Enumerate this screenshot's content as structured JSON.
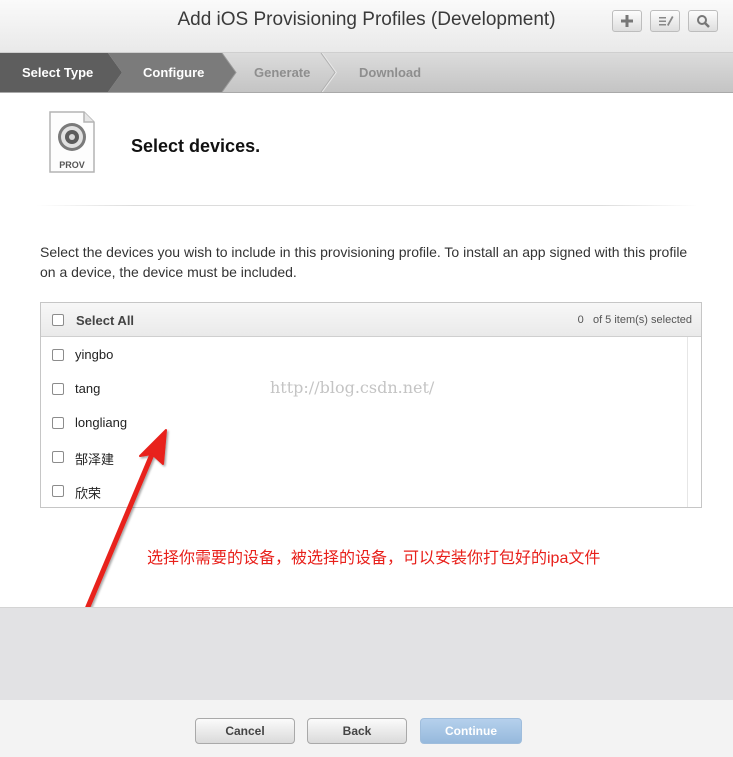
{
  "window": {
    "title": "Add iOS Provisioning Profiles (Development)",
    "toolbar_icons": [
      "plus-icon",
      "edit-icon",
      "search-icon"
    ]
  },
  "steps": [
    {
      "label": "Select Type",
      "state": "done"
    },
    {
      "label": "Configure",
      "state": "active"
    },
    {
      "label": "Generate",
      "state": "pending"
    },
    {
      "label": "Download",
      "state": "pending"
    }
  ],
  "header": {
    "icon_label": "PROV",
    "heading": "Select devices."
  },
  "description": "Select the devices you wish to include in this provisioning profile. To install an app signed with this profile on a device, the device must be included.",
  "device_list": {
    "select_all_label": "Select All",
    "selected_count": "0",
    "count_suffix": "of 5 item(s) selected",
    "devices": [
      {
        "name": "yingbo",
        "checked": false
      },
      {
        "name": "tang",
        "checked": false
      },
      {
        "name": "longliang",
        "checked": false
      },
      {
        "name": "郜泽建",
        "checked": false
      },
      {
        "name": "欣荣",
        "checked": false
      }
    ]
  },
  "watermark": "http://blog.csdn.net/",
  "annotation": "选择你需要的设备，被选择的设备，可以安装你打包好的ipa文件",
  "annotation_color": "#e8201b",
  "footer": {
    "cancel_label": "Cancel",
    "back_label": "Back",
    "continue_label": "Continue"
  },
  "colors": {
    "steps_done_bg": "#5a5a5a",
    "steps_active_bg": "#7a7a7a",
    "continue_bg": "#a9c8e8"
  }
}
